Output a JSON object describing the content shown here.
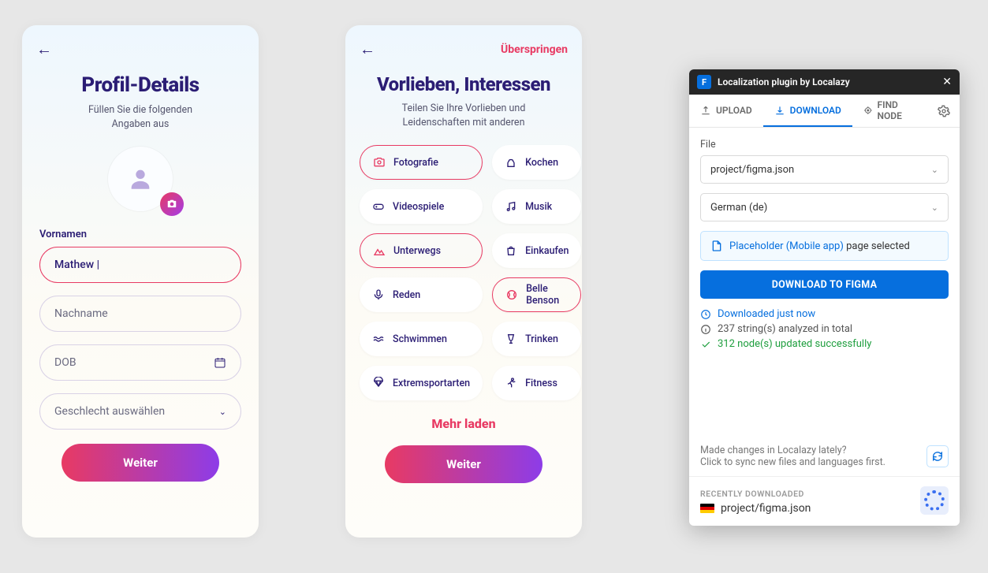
{
  "colors": {
    "brand_purple": "#2b1d74",
    "accent_pink": "#e83a63",
    "accent_purple": "#8d3ce8",
    "blue": "#066fde",
    "green": "#1e9e3e"
  },
  "screen1": {
    "title": "Profil-Details",
    "subtitle": "Füllen Sie die folgenden\nAngaben aus",
    "first_name_label": "Vornamen",
    "first_name_value": "Mathew",
    "last_name_placeholder": "Nachname",
    "dob_placeholder": "DOB",
    "gender_placeholder": "Geschlecht auswählen",
    "cta": "Weiter"
  },
  "screen2": {
    "skip": "Überspringen",
    "title": "Vorlieben, Interessen",
    "subtitle": "Teilen Sie Ihre Vorlieben und\nLeidenschaften mit anderen",
    "chips": [
      {
        "label": "Fotografie",
        "icon": "camera",
        "selected": true
      },
      {
        "label": "Kochen",
        "icon": "chef",
        "selected": false
      },
      {
        "label": "Videospiele",
        "icon": "gamepad",
        "selected": false
      },
      {
        "label": "Musik",
        "icon": "music",
        "selected": false
      },
      {
        "label": "Unterwegs",
        "icon": "hike",
        "selected": true
      },
      {
        "label": "Einkaufen",
        "icon": "bag",
        "selected": false
      },
      {
        "label": "Reden",
        "icon": "mic",
        "selected": false
      },
      {
        "label": "Belle Benson",
        "icon": "tennis",
        "selected": true
      },
      {
        "label": "Schwimmen",
        "icon": "waves",
        "selected": false
      },
      {
        "label": "Trinken",
        "icon": "glass",
        "selected": false
      },
      {
        "label": "Extremsportarten",
        "icon": "parachute",
        "selected": false
      },
      {
        "label": "Fitness",
        "icon": "run",
        "selected": false
      }
    ],
    "load_more": "Mehr laden",
    "cta": "Weiter"
  },
  "plugin": {
    "title": "Localization plugin by Localazy",
    "tabs": {
      "upload": "UPLOAD",
      "download": "DOWNLOAD",
      "find": "FIND NODE"
    },
    "file_label": "File",
    "file_value": "project/figma.json",
    "lang_value": "German (de)",
    "banner_link": "Placeholder (Mobile app)",
    "banner_tail": " page selected",
    "download_btn": "DOWNLOAD TO FIGMA",
    "status": {
      "line1": "Downloaded just now",
      "line2": "237 string(s) analyzed in total",
      "line3": "312 node(s) updated successfully"
    },
    "sync1": "Made changes in Localazy lately?",
    "sync2": "Click to sync new files and languages first.",
    "recent_label": "RECENTLY DOWNLOADED",
    "recent_file": "project/figma.json"
  }
}
